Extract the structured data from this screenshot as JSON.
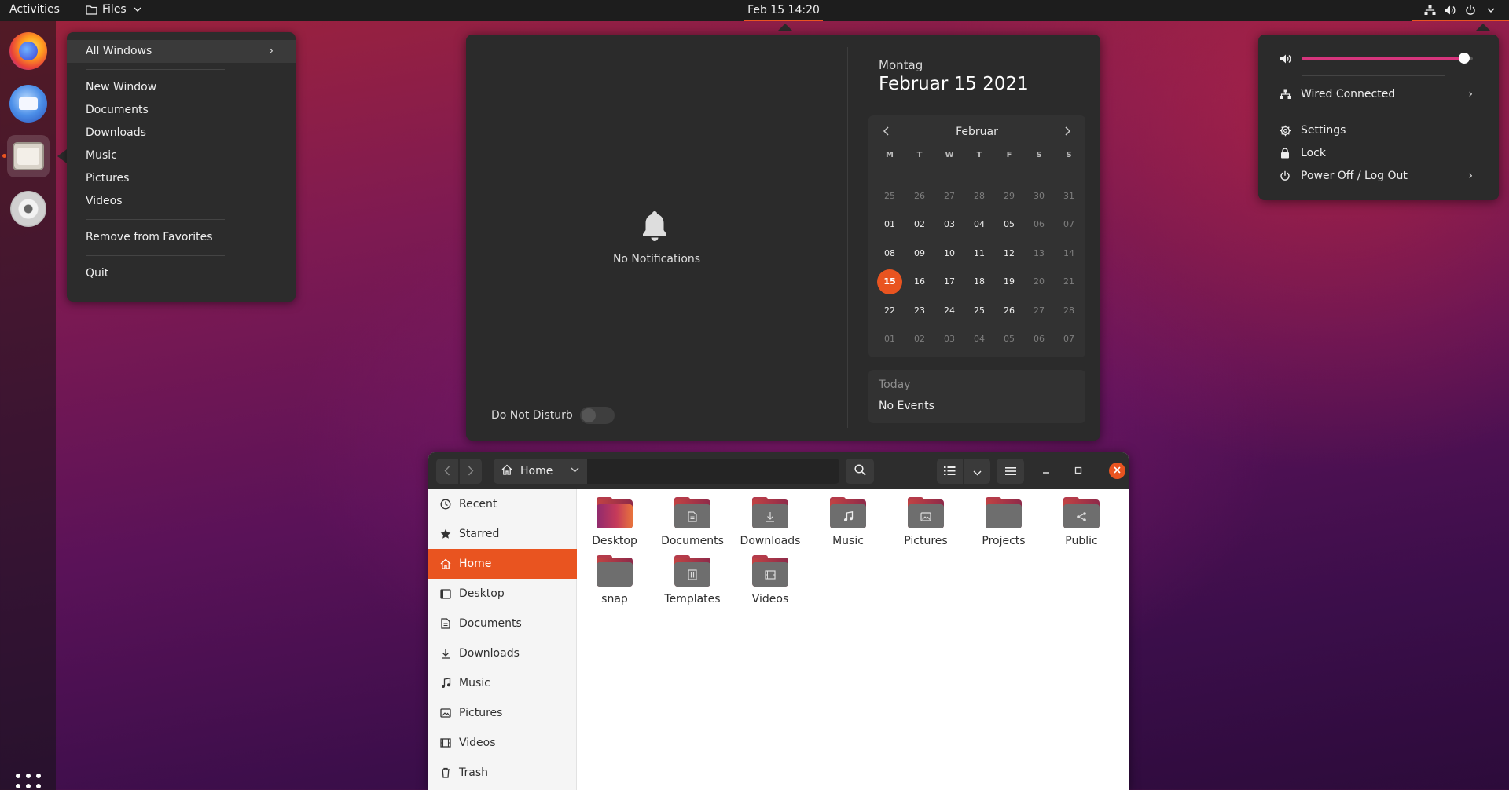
{
  "topbar": {
    "activities": "Activities",
    "app_menu": "Files",
    "clock": "Feb 15  14:20"
  },
  "dock": {
    "apps": [
      "firefox",
      "thunderbird",
      "files",
      "disc"
    ],
    "show_apps_icon": "grid-icon"
  },
  "context_menu": {
    "all_windows": "All Windows",
    "items_group1": [
      "New Window",
      "Documents",
      "Downloads",
      "Music",
      "Pictures",
      "Videos"
    ],
    "remove_favorites": "Remove from Favorites",
    "quit": "Quit"
  },
  "notifications": {
    "empty": "No Notifications",
    "dnd_label": "Do Not Disturb"
  },
  "calendar": {
    "weekday": "Montag",
    "full_date": "Februar 15 2021",
    "month": "Februar",
    "day_headers": [
      "M",
      "T",
      "W",
      "T",
      "F",
      "S",
      "S"
    ],
    "weeks": [
      [
        "25",
        "26",
        "27",
        "28",
        "29",
        "30",
        "31"
      ],
      [
        "01",
        "02",
        "03",
        "04",
        "05",
        "06",
        "07"
      ],
      [
        "08",
        "09",
        "10",
        "11",
        "12",
        "13",
        "14"
      ],
      [
        "15",
        "16",
        "17",
        "18",
        "19",
        "20",
        "21"
      ],
      [
        "22",
        "23",
        "24",
        "25",
        "26",
        "27",
        "28"
      ],
      [
        "01",
        "02",
        "03",
        "04",
        "05",
        "06",
        "07"
      ]
    ],
    "today": "15",
    "events_header": "Today",
    "events_none": "No Events"
  },
  "system_menu": {
    "volume_level": 0.95,
    "wired": "Wired Connected",
    "settings": "Settings",
    "lock": "Lock",
    "power": "Power Off / Log Out"
  },
  "files": {
    "path": "Home",
    "sidebar": [
      {
        "label": "Recent",
        "icon": "clock-icon"
      },
      {
        "label": "Starred",
        "icon": "star-icon"
      },
      {
        "label": "Home",
        "icon": "home-icon"
      },
      {
        "label": "Desktop",
        "icon": "desktop-icon"
      },
      {
        "label": "Documents",
        "icon": "document-icon"
      },
      {
        "label": "Downloads",
        "icon": "download-icon"
      },
      {
        "label": "Music",
        "icon": "music-icon"
      },
      {
        "label": "Pictures",
        "icon": "picture-icon"
      },
      {
        "label": "Videos",
        "icon": "video-icon"
      },
      {
        "label": "Trash",
        "icon": "trash-icon"
      }
    ],
    "folders": [
      {
        "label": "Desktop",
        "icon": "desktop-folder-icon"
      },
      {
        "label": "Documents",
        "icon": "documents-folder-icon"
      },
      {
        "label": "Downloads",
        "icon": "downloads-folder-icon"
      },
      {
        "label": "Music",
        "icon": "music-folder-icon"
      },
      {
        "label": "Pictures",
        "icon": "pictures-folder-icon"
      },
      {
        "label": "Projects",
        "icon": "folder-icon"
      },
      {
        "label": "Public",
        "icon": "public-folder-icon"
      },
      {
        "label": "snap",
        "icon": "folder-icon"
      },
      {
        "label": "Templates",
        "icon": "templates-folder-icon"
      },
      {
        "label": "Videos",
        "icon": "videos-folder-icon"
      }
    ]
  },
  "colors": {
    "accent": "#e95420",
    "panel": "#2b2b2b",
    "topbar": "#1d1d1d"
  }
}
